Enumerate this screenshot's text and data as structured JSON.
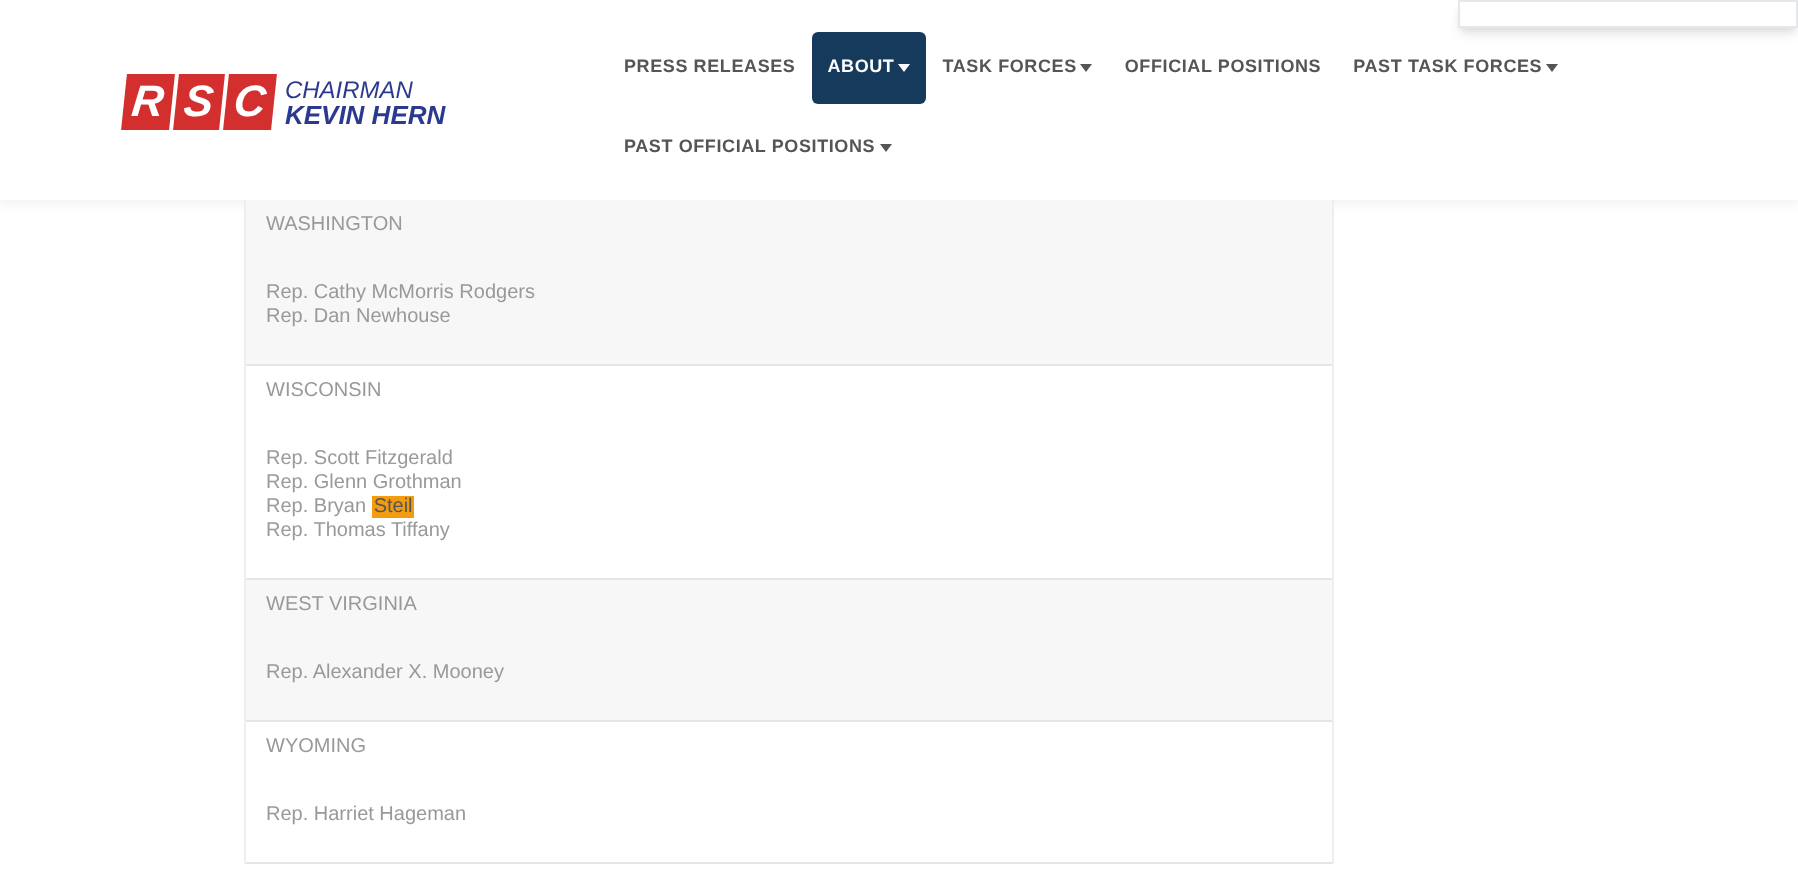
{
  "logo": {
    "letters": [
      "R",
      "S",
      "C"
    ],
    "title": "CHAIRMAN",
    "name": "KEVIN HERN"
  },
  "nav": [
    {
      "label": "PRESS RELEASES",
      "selected": false,
      "dropdown": false
    },
    {
      "label": "ABOUT",
      "selected": true,
      "dropdown": true
    },
    {
      "label": "TASK FORCES",
      "selected": false,
      "dropdown": true
    },
    {
      "label": "OFFICIAL POSITIONS",
      "selected": false,
      "dropdown": false
    },
    {
      "label": "PAST TASK FORCES",
      "selected": false,
      "dropdown": true
    },
    {
      "label": "PAST OFFICIAL POSITIONS",
      "selected": false,
      "dropdown": true
    }
  ],
  "states": [
    {
      "name": "WASHINGTON",
      "members": [
        {
          "text": "Rep. Cathy McMorris Rodgers"
        },
        {
          "text": "Rep. Dan Newhouse"
        }
      ]
    },
    {
      "name": "WISCONSIN",
      "members": [
        {
          "text": "Rep. Scott Fitzgerald"
        },
        {
          "text": "Rep. Glenn Grothman"
        },
        {
          "text": "Rep. Bryan ",
          "highlight": "Steil"
        },
        {
          "text": "Rep. Thomas Tiffany"
        }
      ]
    },
    {
      "name": "WEST VIRGINIA",
      "members": [
        {
          "text": "Rep. Alexander X. Mooney"
        }
      ]
    },
    {
      "name": "WYOMING",
      "members": [
        {
          "text": "Rep. Harriet Hageman"
        }
      ]
    }
  ]
}
